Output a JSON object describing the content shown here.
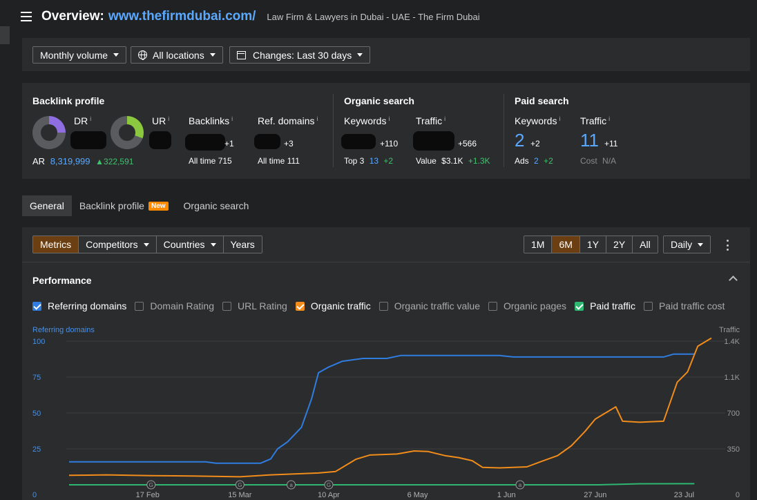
{
  "header": {
    "overview_label": "Overview:",
    "url": "www.thefirmdubai.com/",
    "description": "Law Firm & Lawyers in Dubai - UAE - The Firm Dubai"
  },
  "filters": {
    "volume": "Monthly volume",
    "locations": "All locations",
    "changes": "Changes: Last 30 days"
  },
  "backlink_profile": {
    "title": "Backlink profile",
    "dr_label": "DR",
    "ur_label": "UR",
    "backlinks_label": "Backlinks",
    "backlinks_change": "+1",
    "backlinks_alltime_label": "All time",
    "backlinks_alltime": "715",
    "refdomains_label": "Ref. domains",
    "refdomains_change": "+3",
    "refdomains_alltime_label": "All time",
    "refdomains_alltime": "111",
    "ar_label": "AR",
    "ar_value": "8,319,999",
    "ar_change": "322,591",
    "info": "i"
  },
  "organic_search": {
    "title": "Organic search",
    "keywords_label": "Keywords",
    "keywords_change": "+110",
    "traffic_label": "Traffic",
    "traffic_change": "+566",
    "top3_label": "Top 3",
    "top3_value": "13",
    "top3_change": "+2",
    "value_label": "Value",
    "value_value": "$3.1K",
    "value_change": "+1.3K"
  },
  "paid_search": {
    "title": "Paid search",
    "keywords_label": "Keywords",
    "keywords_value": "2",
    "keywords_change": "+2",
    "traffic_label": "Traffic",
    "traffic_value": "11",
    "traffic_change": "+11",
    "ads_label": "Ads",
    "ads_value": "2",
    "ads_change": "+2",
    "cost_label": "Cost",
    "cost_value": "N/A"
  },
  "tabs": [
    {
      "label": "General"
    },
    {
      "label": "Backlink profile",
      "badge": "New"
    },
    {
      "label": "Organic search"
    }
  ],
  "controls": {
    "views": [
      "Metrics",
      "Competitors",
      "Countries",
      "Years"
    ],
    "ranges": [
      "1M",
      "6M",
      "1Y",
      "2Y",
      "All"
    ],
    "interval": "Daily"
  },
  "performance": {
    "title": "Performance",
    "legend": [
      {
        "label": "Referring domains",
        "checked": true,
        "color": "#2f7de1"
      },
      {
        "label": "Domain Rating",
        "checked": false
      },
      {
        "label": "URL Rating",
        "checked": false
      },
      {
        "label": "Organic traffic",
        "checked": true,
        "color": "#f28c1a"
      },
      {
        "label": "Organic traffic value",
        "checked": false
      },
      {
        "label": "Organic pages",
        "checked": false
      },
      {
        "label": "Paid traffic",
        "checked": true,
        "color": "#2eb872"
      },
      {
        "label": "Paid traffic cost",
        "checked": false
      }
    ]
  },
  "chart_data": {
    "type": "line",
    "ylabel_left": "Referring domains",
    "ylabel_right": "Traffic",
    "left_ticks": [
      "0",
      "25",
      "50",
      "75",
      "100"
    ],
    "right_ticks": [
      "0",
      "350",
      "700",
      "1.1K",
      "1.4K"
    ],
    "x_ticks": [
      "17 Feb",
      "15 Mar",
      "10 Apr",
      "6 May",
      "1 Jun",
      "27 Jun",
      "23 Jul"
    ],
    "ylim_left": [
      0,
      100
    ],
    "ylim_right": [
      0,
      1400
    ],
    "annotations": [
      {
        "date": "2024-02-18",
        "label": "G"
      },
      {
        "date": "2024-03-15",
        "label": "G"
      },
      {
        "date": "2024-03-30",
        "label": "a"
      },
      {
        "date": "2024-04-10",
        "label": "G"
      },
      {
        "date": "2024-06-05",
        "label": "a"
      }
    ],
    "series": [
      {
        "name": "Referring domains",
        "axis": "left",
        "color": "#2f7de1",
        "points": [
          [
            "2024-01-25",
            16
          ],
          [
            "2024-03-05",
            16
          ],
          [
            "2024-03-08",
            15
          ],
          [
            "2024-03-21",
            15
          ],
          [
            "2024-03-24",
            18
          ],
          [
            "2024-03-26",
            25
          ],
          [
            "2024-03-29",
            30
          ],
          [
            "2024-04-02",
            40
          ],
          [
            "2024-04-05",
            60
          ],
          [
            "2024-04-07",
            78
          ],
          [
            "2024-04-10",
            82
          ],
          [
            "2024-04-14",
            86
          ],
          [
            "2024-04-20",
            88
          ],
          [
            "2024-04-27",
            88
          ],
          [
            "2024-05-01",
            90
          ],
          [
            "2024-05-30",
            90
          ],
          [
            "2024-06-03",
            89
          ],
          [
            "2024-06-18",
            89
          ],
          [
            "2024-07-17",
            89
          ],
          [
            "2024-07-20",
            91
          ],
          [
            "2024-07-26",
            91
          ]
        ]
      },
      {
        "name": "Organic traffic",
        "axis": "right",
        "color": "#f28c1a",
        "points": [
          [
            "2024-01-25",
            92
          ],
          [
            "2024-02-05",
            97
          ],
          [
            "2024-02-18",
            89
          ],
          [
            "2024-03-01",
            86
          ],
          [
            "2024-03-15",
            78
          ],
          [
            "2024-03-24",
            97
          ],
          [
            "2024-04-07",
            115
          ],
          [
            "2024-04-12",
            130
          ],
          [
            "2024-04-18",
            250
          ],
          [
            "2024-04-22",
            290
          ],
          [
            "2024-04-30",
            300
          ],
          [
            "2024-05-05",
            330
          ],
          [
            "2024-05-09",
            325
          ],
          [
            "2024-05-14",
            285
          ],
          [
            "2024-05-18",
            265
          ],
          [
            "2024-05-22",
            235
          ],
          [
            "2024-05-25",
            170
          ],
          [
            "2024-05-30",
            165
          ],
          [
            "2024-06-07",
            175
          ],
          [
            "2024-06-11",
            225
          ],
          [
            "2024-06-16",
            285
          ],
          [
            "2024-06-20",
            380
          ],
          [
            "2024-06-24",
            520
          ],
          [
            "2024-06-27",
            640
          ],
          [
            "2024-06-30",
            700
          ],
          [
            "2024-07-03",
            760
          ],
          [
            "2024-07-05",
            620
          ],
          [
            "2024-07-10",
            610
          ],
          [
            "2024-07-17",
            620
          ],
          [
            "2024-07-21",
            1000
          ],
          [
            "2024-07-24",
            1100
          ],
          [
            "2024-07-27",
            1350
          ],
          [
            "2024-07-31",
            1430
          ]
        ]
      },
      {
        "name": "Paid traffic",
        "axis": "right",
        "color": "#2eb872",
        "points": [
          [
            "2024-01-25",
            0
          ],
          [
            "2024-06-28",
            0
          ],
          [
            "2024-07-10",
            10
          ],
          [
            "2024-07-26",
            11
          ]
        ]
      }
    ]
  }
}
